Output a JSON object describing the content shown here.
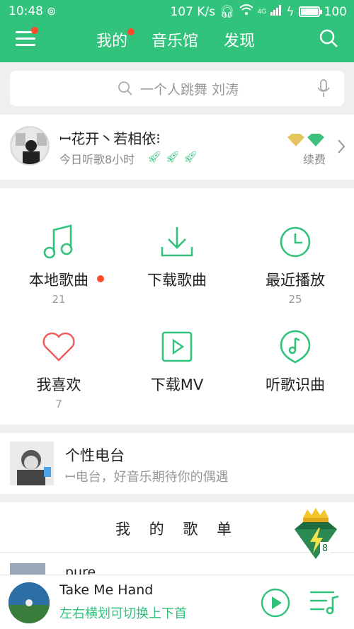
{
  "status": {
    "time": "10:48",
    "speed": "107 K/s",
    "net": "4G",
    "battery": "100",
    "battery_fraction": 1.0
  },
  "tabs": {
    "mine": "我的",
    "library": "音乐馆",
    "discover": "发现"
  },
  "search": {
    "placeholder": "一个人跳舞  刘涛"
  },
  "profile": {
    "name": "ꟷ花开丶若相依⁝",
    "listen": "今日听歌8小时",
    "renew": "续费"
  },
  "grid": {
    "local": {
      "label": "本地歌曲",
      "count": "21"
    },
    "download": {
      "label": "下载歌曲",
      "count": ""
    },
    "recent": {
      "label": "最近播放",
      "count": "25"
    },
    "liked": {
      "label": "我喜欢",
      "count": "7"
    },
    "mv": {
      "label": "下载MV",
      "count": ""
    },
    "identify": {
      "label": "听歌识曲",
      "count": ""
    }
  },
  "radio": {
    "title": "个性电台",
    "subtitle": "ꟷ电台，好音乐期待你的偶遇"
  },
  "playlist": {
    "title": "我 的 歌 单",
    "first": "pure"
  },
  "player": {
    "song": "Take Me Hand",
    "tip": "左右横划可切换上下首"
  },
  "colors": {
    "accent": "#31c27c",
    "badge": "#ff4b2b"
  }
}
